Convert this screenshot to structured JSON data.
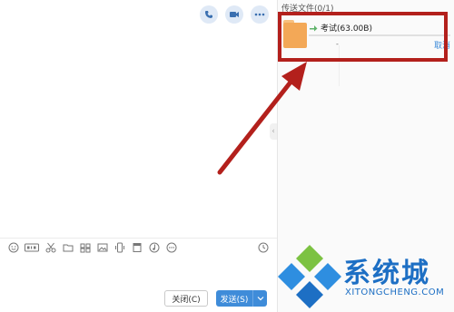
{
  "side_panel": {
    "title": "传送文件(0/1)",
    "file": {
      "name": "考试(63.00B)",
      "size_text": "-",
      "cancel_label": "取消",
      "progress_fraction": 0
    }
  },
  "toolbar": {
    "icons": [
      "emoji-icon",
      "gif-icon",
      "scissors-icon",
      "folder-icon",
      "image-gallery-icon",
      "image-icon",
      "phone-screen-icon",
      "archive-icon",
      "music-icon",
      "more-icon"
    ]
  },
  "buttons": {
    "close_label": "关闭(C)",
    "send_label": "发送(S)"
  },
  "watermark": {
    "cn": "系统城",
    "en": "XITONGCHENG.COM"
  },
  "colors": {
    "accent": "#3f8cd9",
    "highlight": "#b3201c",
    "folder": "#f3a857",
    "watermark": "#1d6fc4"
  }
}
